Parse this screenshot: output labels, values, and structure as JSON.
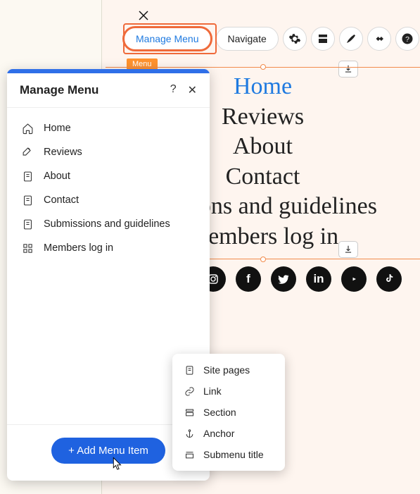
{
  "toolbar": {
    "manage_menu": "Manage Menu",
    "navigate": "Navigate"
  },
  "canvas": {
    "menu_tag": "Menu",
    "nav_items": [
      "Home",
      "Reviews",
      "About",
      "Contact",
      "missions and guidelines",
      "Members log in"
    ],
    "active_index": 0
  },
  "socials": [
    "instagram",
    "facebook",
    "twitter",
    "linkedin",
    "youtube",
    "tiktok"
  ],
  "panel": {
    "title": "Manage Menu",
    "items": [
      {
        "label": "Home",
        "icon": "home"
      },
      {
        "label": "Reviews",
        "icon": "pen"
      },
      {
        "label": "About",
        "icon": "page"
      },
      {
        "label": "Contact",
        "icon": "page"
      },
      {
        "label": "Submissions and guidelines",
        "icon": "page"
      },
      {
        "label": "Members log in",
        "icon": "grid"
      }
    ],
    "add_button": "Add Menu Item"
  },
  "add_dropdown": {
    "items": [
      {
        "label": "Site pages",
        "icon": "page"
      },
      {
        "label": "Link",
        "icon": "link"
      },
      {
        "label": "Section",
        "icon": "section"
      },
      {
        "label": "Anchor",
        "icon": "anchor"
      },
      {
        "label": "Submenu title",
        "icon": "submenu"
      }
    ]
  }
}
